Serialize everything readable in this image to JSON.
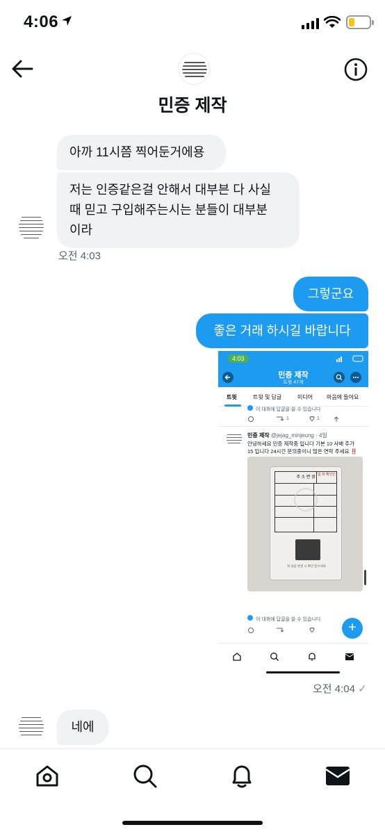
{
  "status_bar": {
    "time": "4:06"
  },
  "header": {
    "title": "민증 제작"
  },
  "messages": {
    "m1": "아까 11시쯤 찍어둔거에용",
    "m2_l1": "저는 인증같은걸 안해서 대부븐 다 사실",
    "m2_l2": "때 믿고 구입해주는시는 분들이 대부분",
    "m2_l3": "이라",
    "ts1": "오전 4:03",
    "m3": "그렇군요",
    "m4": "좋은 거래 하시길 바랍니다",
    "ts2": "오전 4:04",
    "m5": "네에"
  },
  "embed": {
    "time": "4:03",
    "title": "민증 제작",
    "subtitle": "트윗 47개",
    "tabs": [
      "트윗",
      "트윗 및 답글",
      "미디어",
      "마음에 들어요"
    ],
    "reply_notice": "이 대화에 답글을 쓸 수 있습니다",
    "stats": {
      "retweets": "1",
      "likes": "1"
    },
    "tweet_name": "민증 제작",
    "tweet_handle": "@jejag_minjeung · 4일",
    "tweet_text_l1": "안녕하세요 민증 제작중 입니다 기본 10 사배 추가",
    "tweet_text_l2": "15 입니다 24시간 문의중이니 많은 연락 주세요 ‼️",
    "card_header": "주 소 변 경",
    "card_side": "일 자 확인인",
    "card_foot": "위 내용 변경 시 확인 받으세요"
  },
  "icons": {
    "back": "arrow-left-icon",
    "info": "info-icon",
    "home": "home-icon",
    "search": "search-icon",
    "notifications": "bell-icon",
    "messages": "envelope-icon"
  },
  "colors": {
    "accent": "#1d9bf0",
    "bubble_in": "#eff3f4",
    "battery": "#f5c518"
  }
}
